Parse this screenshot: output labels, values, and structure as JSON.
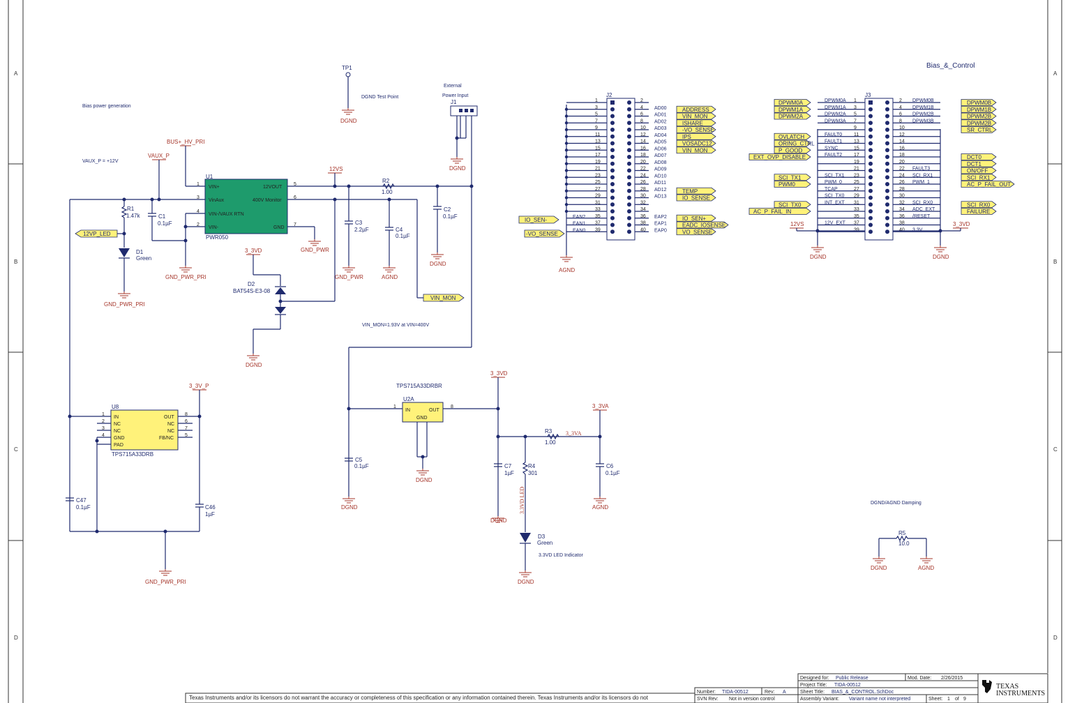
{
  "sheet": {
    "title_block": {
      "designed_for_label": "Designed for:",
      "designed_for": "Public Release",
      "mod_date_label": "Mod. Date:",
      "mod_date": "2/26/2015",
      "project_title_label": "Project Title:",
      "project_title": "TIDA-00512",
      "sheet_title_label": "Sheet Title:",
      "sheet_title": "BIAS_&_CONTROL.SchDoc",
      "assembly_label": "Assembly Variant:",
      "assembly": "Variant name not interpreted",
      "sheet_label": "Sheet:",
      "sheet_no": "1",
      "of_label": "of",
      "sheet_total": "9",
      "number_label": "Number:",
      "number": "TIDA-00512",
      "rev_label": "Rev:",
      "rev": "A",
      "svn_label": "SVN Rev:",
      "svn": "Not in version control",
      "disclaimer": "Texas Instruments and/or its licensors do not warrant the accuracy or completeness of this specification or any information contained therein. Texas Instruments and/or its licensors do not",
      "company_line1": "TEXAS",
      "company_line2": "INSTRUMENTS"
    },
    "zones_rows": [
      "A",
      "B",
      "C",
      "D"
    ],
    "sheet_name": "Bias_&_Control"
  },
  "notes": {
    "bias_power": "Bias power generation",
    "vaux": "VAUX_P = +12V",
    "dgnd_test": "DGND Test Point",
    "ext_power_1": "External",
    "ext_power_2": "Power Input",
    "vin_mon_note": "VIN_MON=1.93V at VIN=400V",
    "led_indicator": "3.3VD LED Indicator",
    "damping": "DGND/AGND Damping",
    "led_rotated": "3.3VD LED"
  },
  "nets": {
    "bus_hv": "BUS+_HV_PRI",
    "vaux_p": "VAUX_P",
    "v12vs": "12VS",
    "v3_3vd": "3_3VD",
    "v3_3v_p": "3_3V_P",
    "v3_3va": "3_3VA",
    "dgnd": "DGND",
    "agnd": "AGND",
    "gnd_pwr": "GND_PWR",
    "gnd_pwr_pri": "GND_PWR_PRI",
    "tp1": "TP1",
    "j1": "J1",
    "r3_net": "3_3VA"
  },
  "components": {
    "u1": {
      "ref": "U1",
      "part": "PWR050",
      "pins_left": [
        {
          "num": "1",
          "name": "VIN+"
        },
        {
          "num": "3",
          "name": "VinAux"
        },
        {
          "num": "4",
          "name": "VIN-/VAUX RTN"
        },
        {
          "num": "2",
          "name": "VIN-"
        }
      ],
      "pins_right": [
        {
          "num": "5",
          "name": "12VOUT"
        },
        {
          "num": "6",
          "name": "400V Monitor"
        },
        {
          "num": "7",
          "name": "GND"
        }
      ]
    },
    "u8": {
      "ref": "U8",
      "part": "TPS715A33DRB",
      "pins_left": [
        {
          "num": "1",
          "name": "IN"
        },
        {
          "num": "2",
          "name": "NC"
        },
        {
          "num": "3",
          "name": "NC"
        },
        {
          "num": "4",
          "name": "GND"
        },
        {
          "num": "",
          "name": "PAD"
        }
      ],
      "pins_right": [
        {
          "num": "8",
          "name": "OUT"
        },
        {
          "num": "6",
          "name": "NC"
        },
        {
          "num": "7",
          "name": "NC"
        },
        {
          "num": "5",
          "name": "FB/NC"
        }
      ]
    },
    "u2a": {
      "ref": "U2A",
      "part": "TPS715A33DRBR",
      "pins": [
        {
          "num": "1",
          "name": "IN"
        },
        {
          "num": "8",
          "name": "OUT"
        },
        {
          "num": "",
          "name": "GND"
        }
      ]
    },
    "r1": {
      "ref": "R1",
      "value": "1.47k"
    },
    "c1": {
      "ref": "C1",
      "value": "0.1µF"
    },
    "d1": {
      "ref": "D1",
      "value": "Green"
    },
    "r2": {
      "ref": "R2",
      "value": "1.00"
    },
    "c2": {
      "ref": "C2",
      "value": "0.1µF"
    },
    "c3": {
      "ref": "C3",
      "value": "2.2µF"
    },
    "c4": {
      "ref": "C4",
      "value": "0.1µF"
    },
    "d2": {
      "ref": "D2",
      "value": "BAT54S-E3-08"
    },
    "c5": {
      "ref": "C5",
      "value": "0.1µF"
    },
    "c7": {
      "ref": "C7",
      "value": "1µF"
    },
    "r4": {
      "ref": "R4",
      "value": "301"
    },
    "d3": {
      "ref": "D3",
      "value": "Green"
    },
    "r3": {
      "ref": "R3",
      "value": "1.00"
    },
    "c6": {
      "ref": "C6",
      "value": "0.1µF"
    },
    "c47": {
      "ref": "C47",
      "value": "0.1µF"
    },
    "c46": {
      "ref": "C46",
      "value": "1µF"
    },
    "r5": {
      "ref": "R5",
      "value": "10.0"
    }
  },
  "ports": {
    "v12vp_led": "12VP_LED",
    "vin_mon": "VIN_MON",
    "io_sen_minus": "IO_SEN-",
    "vo_sense_neg": "-VO_SENSE"
  },
  "j2": {
    "ref": "J2",
    "left_nums": [
      "1",
      "3",
      "5",
      "7",
      "9",
      "11",
      "13",
      "15",
      "17",
      "19",
      "21",
      "23",
      "25",
      "27",
      "29",
      "31",
      "33",
      "35",
      "37",
      "39"
    ],
    "right_nums": [
      "2",
      "4",
      "6",
      "8",
      "10",
      "12",
      "14",
      "16",
      "18",
      "20",
      "22",
      "24",
      "26",
      "28",
      "30",
      "32",
      "34",
      "36",
      "38",
      "40"
    ],
    "right_names": [
      "",
      "AD00",
      "AD01",
      "AD02",
      "AD03",
      "AD04",
      "AD05",
      "AD06",
      "AD07",
      "AD08",
      "AD09",
      "AD10",
      "AD11",
      "AD12",
      "AD13",
      "",
      "",
      "EAP2",
      "EAP1",
      "EAP0"
    ],
    "left_names": [
      "",
      "",
      "",
      "",
      "",
      "",
      "",
      "",
      "",
      "",
      "",
      "",
      "",
      "",
      "",
      "",
      "",
      "EAN2",
      "EAN1",
      "EAN0"
    ],
    "right_ports": [
      {
        "row": 2,
        "name": "ADDRESS"
      },
      {
        "row": 3,
        "name": "VIN_MON"
      },
      {
        "row": 4,
        "name": "ISHARE"
      },
      {
        "row": 5,
        "name": "-VO_SENSE"
      },
      {
        "row": 6,
        "name": "IPS"
      },
      {
        "row": 7,
        "name": "VOSADC12"
      },
      {
        "row": 8,
        "name": "VIN_MON"
      },
      {
        "row": 14,
        "name": "TEMP"
      },
      {
        "row": 15,
        "name": "IO_SENSE"
      },
      {
        "row": 18,
        "name": "IO_SEN+"
      },
      {
        "row": 19,
        "name": "EADC_IOSENSE"
      },
      {
        "row": 20,
        "name": "VO_SENSE"
      }
    ]
  },
  "j3": {
    "ref": "J3",
    "left_nums": [
      "1",
      "3",
      "5",
      "7",
      "9",
      "11",
      "13",
      "15",
      "17",
      "19",
      "21",
      "23",
      "25",
      "27",
      "29",
      "31",
      "33",
      "35",
      "37",
      "39"
    ],
    "right_nums": [
      "2",
      "4",
      "6",
      "8",
      "10",
      "12",
      "14",
      "16",
      "18",
      "20",
      "22",
      "24",
      "26",
      "28",
      "30",
      "32",
      "34",
      "36",
      "38",
      "40"
    ],
    "left_names": [
      "DPWM0A",
      "DPWM1A",
      "DPWM2A",
      "DPWM3A",
      "",
      "FAULT0",
      "FAULT1",
      "SYNC",
      "FAULT2",
      "",
      "",
      "SCI_TX1",
      "PWM_0",
      "TCAP",
      "SCI_TX0",
      "INT_EXT",
      "",
      "",
      "12V_EXT",
      ""
    ],
    "right_names": [
      "DPWM0B",
      "DPWM1B",
      "DPWM2B",
      "DPWM3B",
      "",
      "",
      "",
      "",
      "",
      "",
      "FAULT3",
      "SCI_RX1",
      "PWM_1",
      "",
      "",
      "SCI_RX0",
      "ADC_EXT",
      "/RESET",
      "",
      "3.3V"
    ],
    "left_ports": [
      {
        "row": 1,
        "name": "DPWM0A"
      },
      {
        "row": 2,
        "name": "DPWM1A"
      },
      {
        "row": 3,
        "name": "DPWM2A"
      },
      {
        "row": 6,
        "name": "OVLATCH"
      },
      {
        "row": 7,
        "name": "ORING_CTRL"
      },
      {
        "row": 8,
        "name": "P_GOOD"
      },
      {
        "row": 9,
        "name": "EXT_OVP_DISABLE"
      },
      {
        "row": 12,
        "name": "SCI_TX1"
      },
      {
        "row": 13,
        "name": "PWM0"
      },
      {
        "row": 16,
        "name": "SCI_TX0"
      },
      {
        "row": 17,
        "name": "AC_P_FAIL_IN"
      }
    ],
    "right_ports": [
      {
        "row": 1,
        "name": "DPWM0B"
      },
      {
        "row": 2,
        "name": "DPWM1B"
      },
      {
        "row": 3,
        "name": "DPWM2B"
      },
      {
        "row": 4,
        "name": "DPWM2B"
      },
      {
        "row": 5,
        "name": "SR_CTRL"
      },
      {
        "row": 9,
        "name": "DCT0"
      },
      {
        "row": 10,
        "name": "DCT1"
      },
      {
        "row": 11,
        "name": "ON/OFF"
      },
      {
        "row": 12,
        "name": "SCI_RX1"
      },
      {
        "row": 13,
        "name": "AC_P_FAIL_OUT"
      },
      {
        "row": 16,
        "name": "SCI_RX0"
      },
      {
        "row": 17,
        "name": "FAILURE"
      }
    ]
  }
}
